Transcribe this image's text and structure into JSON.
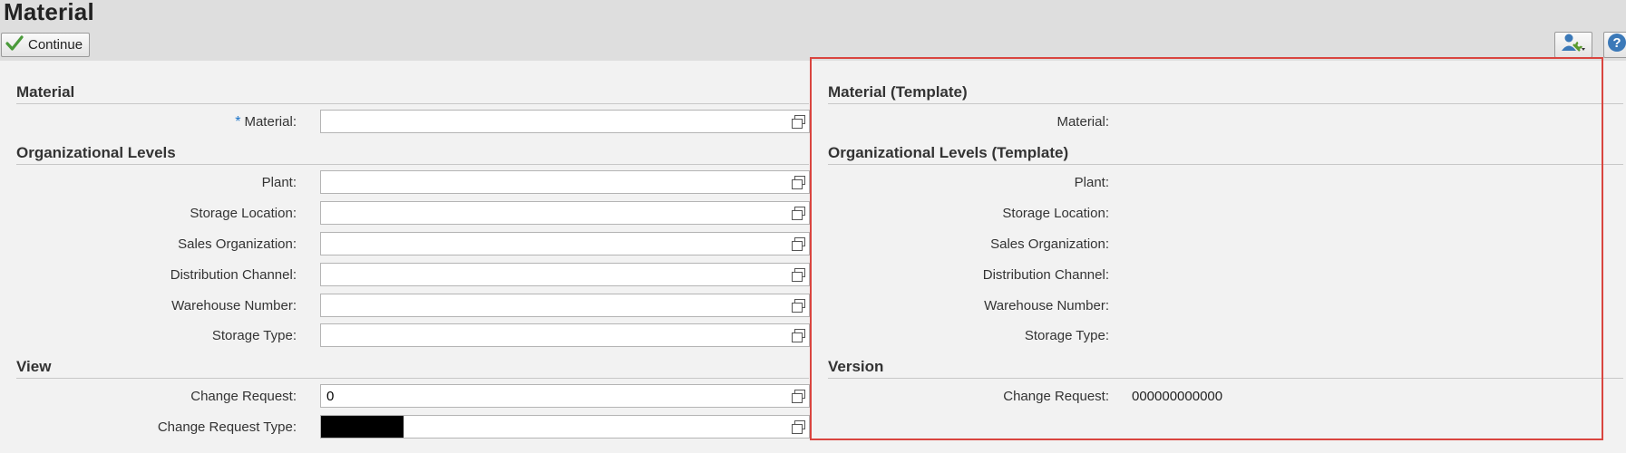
{
  "header": {
    "title": "Material",
    "continue_label": "Continue"
  },
  "left": {
    "material_section": "Material",
    "material_label": "Material:",
    "required_marker": "*",
    "org_section": "Organizational Levels",
    "plant_label": "Plant:",
    "storage_location_label": "Storage Location:",
    "sales_org_label": "Sales Organization:",
    "distribution_channel_label": "Distribution Channel:",
    "warehouse_number_label": "Warehouse Number:",
    "storage_type_label": "Storage Type:",
    "view_section": "View",
    "change_request_label": "Change Request:",
    "change_request_value": "0",
    "change_request_type_label": "Change Request Type:"
  },
  "right": {
    "material_section": "Material (Template)",
    "material_label": "Material:",
    "org_section": "Organizational Levels (Template)",
    "plant_label": "Plant:",
    "storage_location_label": "Storage Location:",
    "sales_org_label": "Sales Organization:",
    "distribution_channel_label": "Distribution Channel:",
    "warehouse_number_label": "Warehouse Number:",
    "storage_type_label": "Storage Type:",
    "version_section": "Version",
    "change_request_label": "Change Request:",
    "change_request_value": "000000000000"
  },
  "icons": {
    "continue": "checkmark-icon",
    "personalize": "user-settings-icon",
    "help": "help-icon",
    "value_help": "value-help-icon"
  },
  "colors": {
    "accent": "#1a73c8",
    "highlight": "#d9453f",
    "check": "#4a9a3a"
  }
}
